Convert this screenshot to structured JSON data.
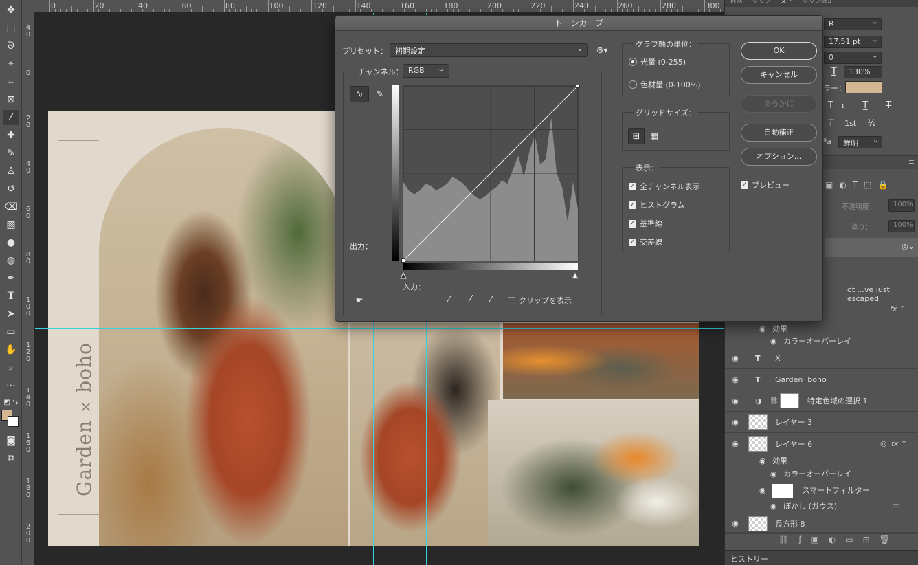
{
  "ruler": {
    "top_labels": [
      "0",
      "20",
      "40",
      "60",
      "80",
      "100",
      "120",
      "140",
      "160",
      "180",
      "200",
      "220",
      "240",
      "260",
      "280",
      "300"
    ],
    "left_labels": [
      "40",
      "0",
      "20",
      "40",
      "60",
      "80",
      "100",
      "120",
      "140",
      "160",
      "180",
      "200"
    ]
  },
  "artboard": {
    "title_left": "Garden",
    "title_x": "×",
    "title_right": "boho"
  },
  "dialog": {
    "title": "トーンカーブ",
    "preset_label": "プリセット：",
    "preset_value": "初期設定",
    "channel_label": "チャンネル：",
    "channel_value": "RGB",
    "output_label": "出力：",
    "input_label": "入力：",
    "clip_label": "クリップを表示",
    "unit_group_title": "グラフ軸の単位：",
    "unit_light": "光量 (0-255)",
    "unit_ink": "色材量 (0-100%)",
    "grid_group_title": "グリッドサイズ：",
    "display_group_title": "表示：",
    "display_options": [
      "全チャンネル表示",
      "ヒストグラム",
      "基準線",
      "交差線"
    ],
    "buttons": {
      "ok": "OK",
      "cancel": "キャンセル",
      "smooth": "滑らかに",
      "auto": "自動補正",
      "options": "オプション..."
    },
    "preview_label": "プレビュー"
  },
  "character_panel": {
    "tabs": [
      "段落",
      "グリフ",
      "文字",
      "グリフ設定"
    ],
    "font_style": "R",
    "size": "17.51 pt",
    "tracking": "0",
    "scale": "130%",
    "color_label": "ラー：",
    "color_value": "#d3b792",
    "antialias": "鮮明",
    "superscript": "1st",
    "fraction": "½"
  },
  "layers_panel": {
    "opacity_label": "不透明度：",
    "opacity_value": "100%",
    "fill_label": "塗り：",
    "fill_value": "100%",
    "truncated_name": "ot ...ve just escaped",
    "rows": [
      {
        "name": "効果"
      },
      {
        "name": "カラーオーバーレイ"
      },
      {
        "name": "X"
      },
      {
        "name": "Garden  boho"
      },
      {
        "name": "特定色域の選択 1"
      },
      {
        "name": "レイヤー 3"
      },
      {
        "name": "レイヤー 6"
      },
      {
        "name": "効果"
      },
      {
        "name": "カラーオーバーレイ"
      },
      {
        "name": "スマートフィルター"
      },
      {
        "name": "ぼかし (ガウス)"
      },
      {
        "name": "長方形 8"
      }
    ],
    "fx_label": "fx"
  },
  "history_panel": {
    "title": "ヒストリー"
  },
  "chart_data": {
    "type": "area",
    "title": "",
    "xlabel": "入力：",
    "ylabel": "出力：",
    "xlim": [
      0,
      255
    ],
    "ylim": [
      0,
      100
    ],
    "x": [
      0,
      8,
      16,
      24,
      32,
      40,
      48,
      56,
      64,
      72,
      80,
      88,
      96,
      104,
      112,
      120,
      128,
      136,
      144,
      152,
      160,
      168,
      176,
      184,
      192,
      200,
      208,
      216,
      224,
      232,
      240,
      248,
      255
    ],
    "series": [
      {
        "values": [
          45,
          40,
          38,
          40,
          44,
          43,
          40,
          42,
          44,
          48,
          46,
          44,
          40,
          37,
          35,
          37,
          40,
          42,
          46,
          44,
          52,
          60,
          48,
          62,
          72,
          55,
          58,
          82,
          50,
          42,
          22,
          45,
          30
        ]
      }
    ],
    "curve": [
      [
        0,
        0
      ],
      [
        255,
        255
      ]
    ],
    "grid": "4x4"
  }
}
